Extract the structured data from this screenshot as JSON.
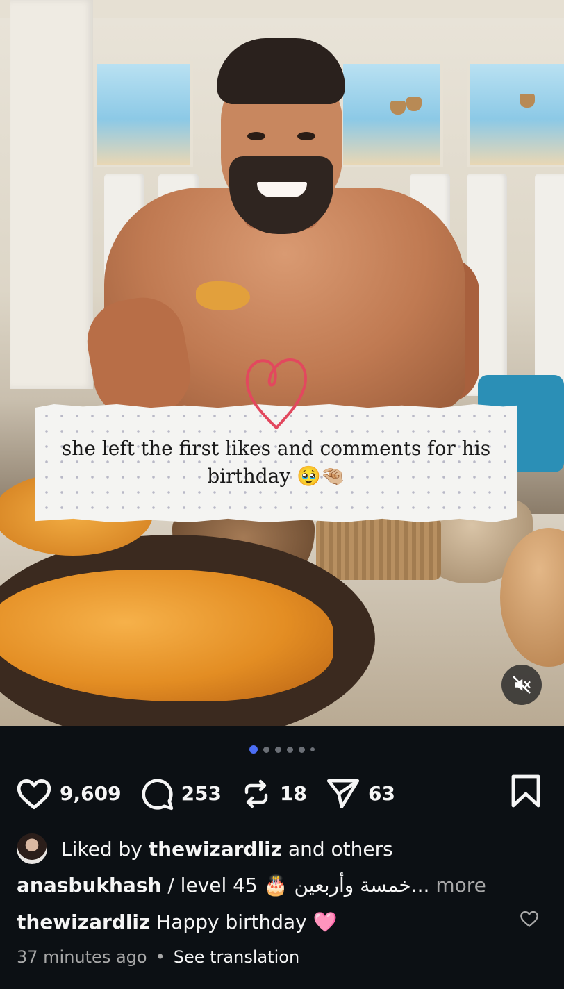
{
  "post": {
    "caption_overlay": "she left the first likes and comments for his birthday 🥹🤏🏼",
    "carousel": {
      "total_dots": 6,
      "active_index": 0
    }
  },
  "actions": {
    "likes": "9,609",
    "comments": "253",
    "reposts": "18",
    "shares": "63"
  },
  "liked_by": {
    "prefix": "Liked by",
    "user": "thewizardliz",
    "suffix": "and others"
  },
  "caption": {
    "username": "anasbukhash",
    "text": "/ level 45 🎂 خمسة وأربعين...",
    "more": "more"
  },
  "comment": {
    "username": "thewizardliz",
    "text": "Happy birthday 🩷"
  },
  "meta": {
    "time": "37 minutes ago",
    "separator": "•",
    "translation": "See translation"
  },
  "icons": {
    "like": "heart-icon",
    "comment": "comment-bubble-icon",
    "repost": "repost-icon",
    "share": "send-icon",
    "save": "bookmark-icon",
    "mute": "speaker-muted-icon"
  },
  "colors": {
    "background": "#0c1014",
    "active_dot": "#4c6ef5",
    "doodle_heart": "#e2485e"
  }
}
